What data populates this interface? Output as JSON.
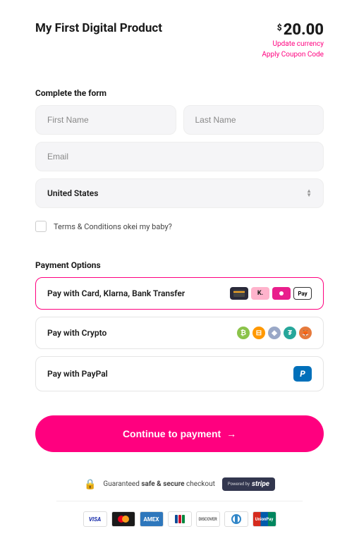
{
  "product": {
    "title": "My First Digital Product"
  },
  "price": {
    "currency_symbol": "$",
    "amount": "20.00"
  },
  "links": {
    "update_currency": "Update currency",
    "apply_coupon": "Apply Coupon Code"
  },
  "form": {
    "heading": "Complete the form",
    "first_name_placeholder": "First Name",
    "last_name_placeholder": "Last Name",
    "email_placeholder": "Email",
    "country_selected": "United States",
    "terms_label": "Terms & Conditions okei my baby?"
  },
  "payment": {
    "heading": "Payment Options",
    "options": [
      {
        "label": "Pay with Card, Klarna, Bank Transfer"
      },
      {
        "label": "Pay with Crypto"
      },
      {
        "label": "Pay with PayPal"
      }
    ]
  },
  "cta": {
    "label": "Continue to payment",
    "arrow": "→"
  },
  "trust": {
    "text_prefix": "Guaranteed ",
    "text_bold": "safe & secure",
    "text_suffix": " checkout",
    "powered_by": "Powered by",
    "stripe": "stripe"
  },
  "card_brands": {
    "visa": "VISA",
    "amex": "AMEX",
    "jcb": "JCB",
    "discover": "DISCOVER",
    "unionpay": "UnionPay"
  },
  "payment_icons": {
    "klarna": "K.",
    "apple_pay": "Pay",
    "paypal": "P",
    "btc": "₿",
    "coin2": "⊟",
    "eth": "◆",
    "tether": "₮",
    "shib": "🦊"
  }
}
